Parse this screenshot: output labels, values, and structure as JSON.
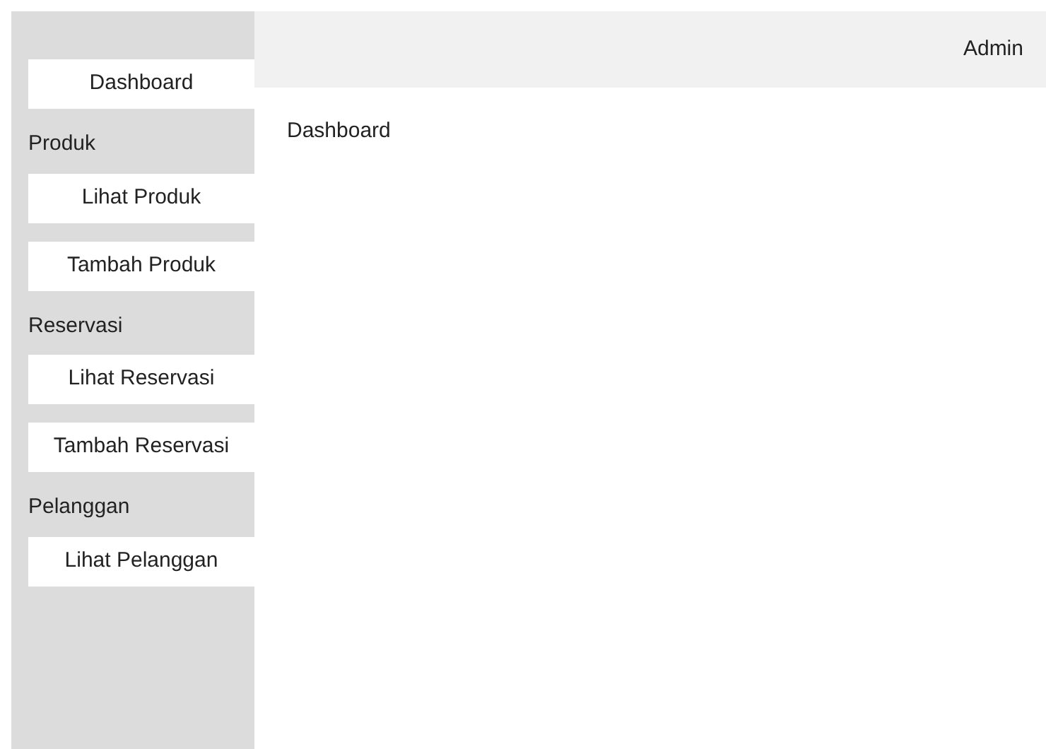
{
  "sidebar": {
    "items": [
      {
        "kind": "button",
        "label": "Dashboard"
      },
      {
        "kind": "section",
        "label": "Produk"
      },
      {
        "kind": "button",
        "label": "Lihat Produk"
      },
      {
        "kind": "button",
        "label": "Tambah Produk"
      },
      {
        "kind": "section",
        "label": "Reservasi"
      },
      {
        "kind": "button",
        "label": "Lihat Reservasi"
      },
      {
        "kind": "button",
        "label": "Tambah Reservasi"
      },
      {
        "kind": "section",
        "label": "Pelanggan"
      },
      {
        "kind": "button",
        "label": "Lihat Pelanggan"
      }
    ]
  },
  "header": {
    "user": "Admin"
  },
  "content": {
    "title": "Dashboard"
  }
}
